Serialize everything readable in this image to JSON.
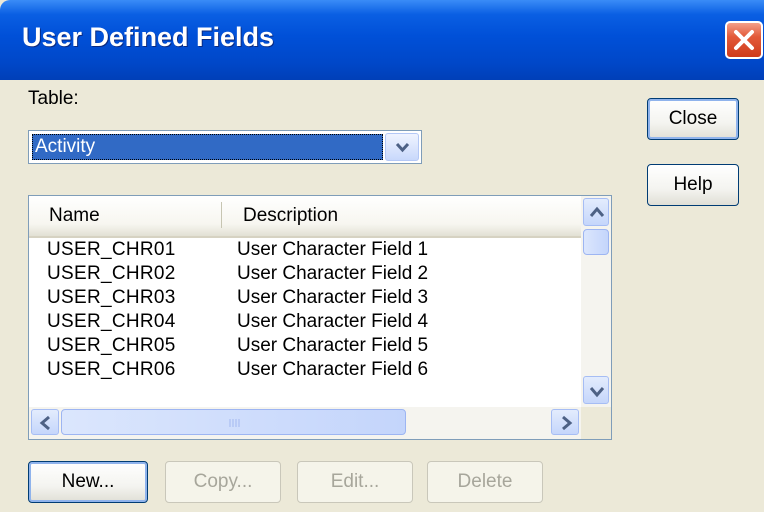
{
  "window": {
    "title": "User Defined Fields"
  },
  "table_label": "Table:",
  "table_select": {
    "selected": "Activity"
  },
  "buttons": {
    "close": "Close",
    "help": "Help",
    "new": "New...",
    "copy": "Copy...",
    "edit": "Edit...",
    "delete": "Delete"
  },
  "list": {
    "columns": [
      "Name",
      "Description"
    ],
    "rows": [
      [
        "USER_CHR01",
        "User Character Field 1"
      ],
      [
        "USER_CHR02",
        "User Character Field 2"
      ],
      [
        "USER_CHR03",
        "User Character Field 3"
      ],
      [
        "USER_CHR04",
        "User Character Field 4"
      ],
      [
        "USER_CHR05",
        "User Character Field 5"
      ],
      [
        "USER_CHR06",
        "User Character Field 6"
      ]
    ]
  },
  "colors": {
    "titlebar": "#0050d8",
    "selection": "#316ac5",
    "dialog_bg": "#ece9d8",
    "close_button": "#e35a3a"
  }
}
